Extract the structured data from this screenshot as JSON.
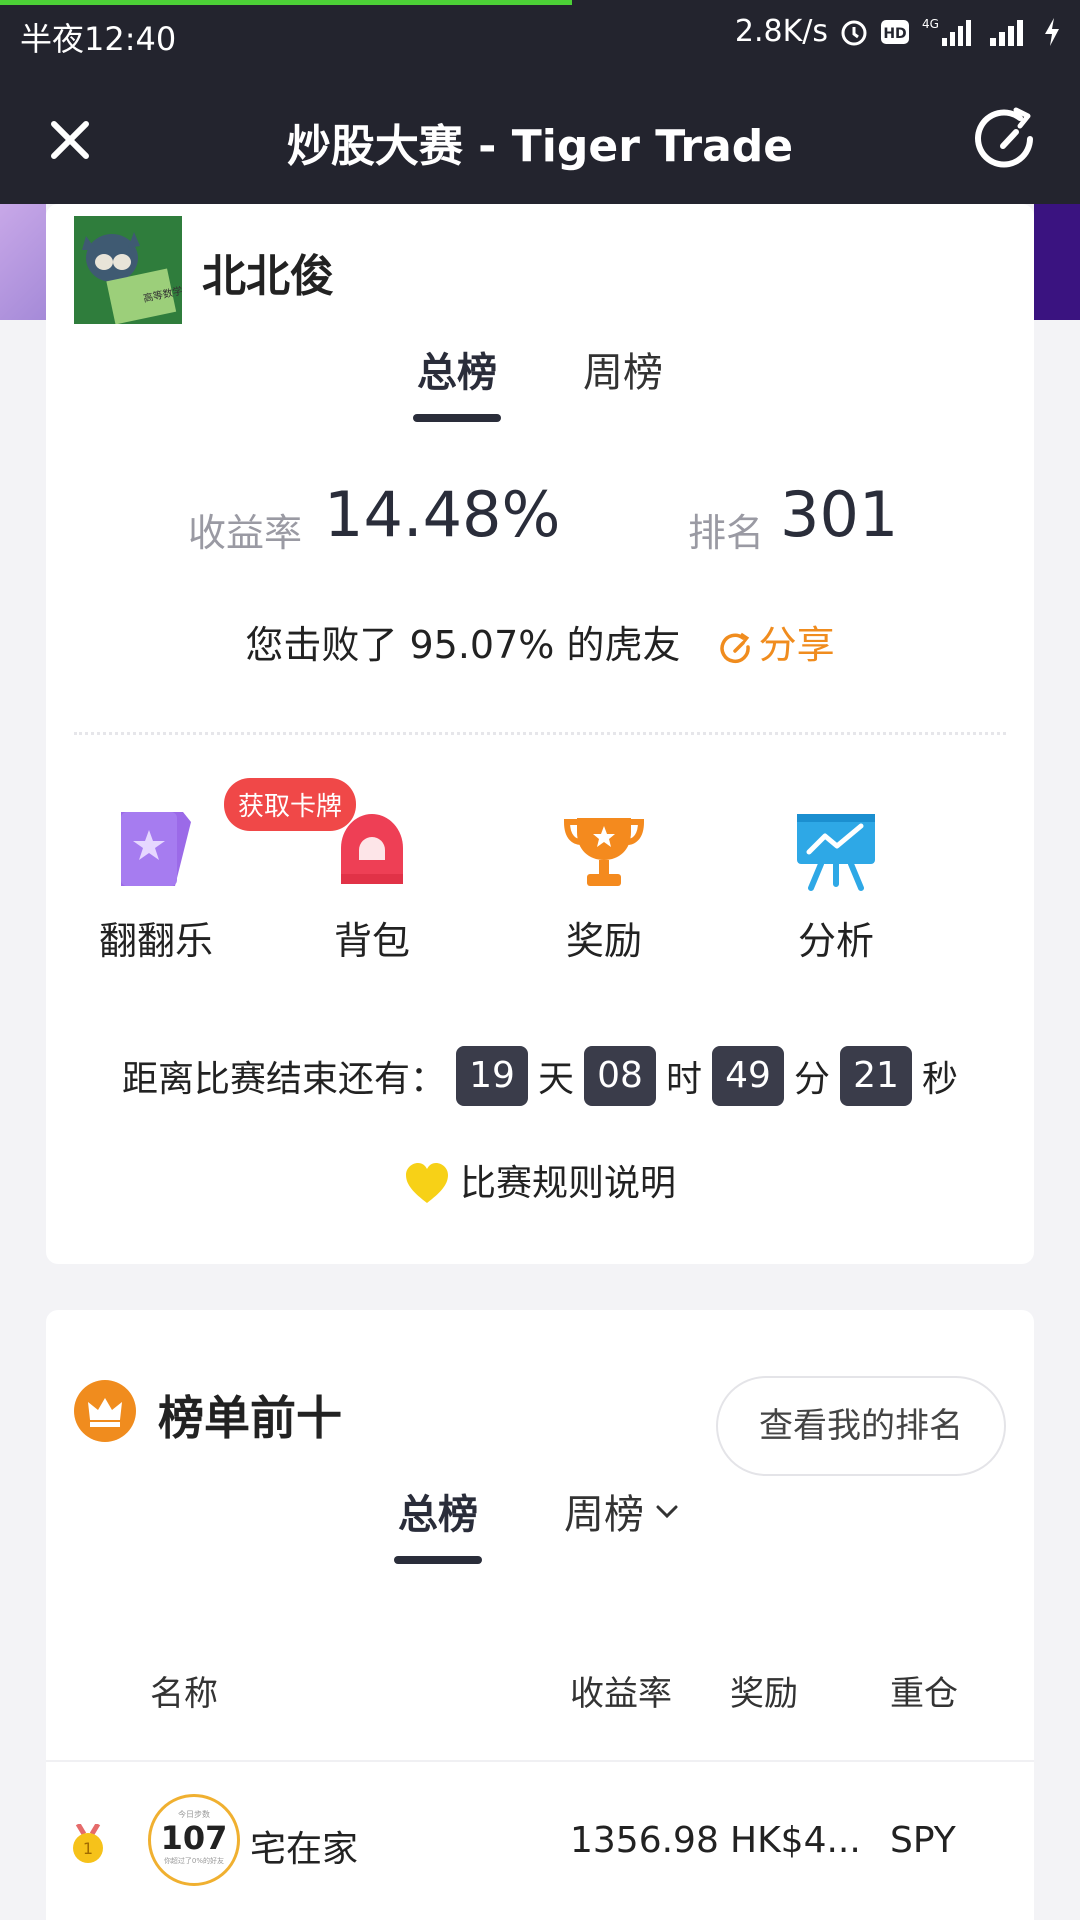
{
  "statusbar": {
    "time": "半夜12:40",
    "speed": "2.8K/s",
    "network": "4G"
  },
  "nav": {
    "title": "炒股大赛 - Tiger Trade"
  },
  "profile": {
    "username": "北北俊"
  },
  "tabs1": {
    "total": "总榜",
    "weekly": "周榜"
  },
  "stats": {
    "return_label": "收益率",
    "return_value": "14.48%",
    "rank_label": "排名",
    "rank_value": "301"
  },
  "beat": {
    "text": "您击败了 95.07% 的虎友",
    "share": "分享"
  },
  "features": [
    {
      "label": "翻翻乐",
      "badge": "获取卡牌"
    },
    {
      "label": "背包"
    },
    {
      "label": "奖励"
    },
    {
      "label": "分析"
    }
  ],
  "countdown": {
    "label": "距离比赛结束还有：",
    "days": "19",
    "days_unit": "天",
    "hours": "08",
    "hours_unit": "时",
    "minutes": "49",
    "minutes_unit": "分",
    "seconds": "21",
    "seconds_unit": "秒"
  },
  "rules": {
    "label": "比赛规则说明"
  },
  "leaderboard": {
    "title": "榜单前十",
    "my_rank_button": "查看我的排名",
    "tab_total": "总榜",
    "tab_weekly": "周榜",
    "columns": {
      "name": "名称",
      "return": "收益率",
      "reward": "奖励",
      "heavy": "重仓"
    },
    "rows": [
      {
        "rank": "1",
        "avatar_top": "今日步数",
        "avatar_num": "107",
        "avatar_bottom": "你超过了0%的好友",
        "name": "宅在家",
        "return": "1356.98%",
        "reward": "HK$4...",
        "heavy": "SPY"
      }
    ]
  },
  "colors": {
    "header_bg": "#23242e",
    "accent": "#f08c1e",
    "badge": "#f04848"
  }
}
